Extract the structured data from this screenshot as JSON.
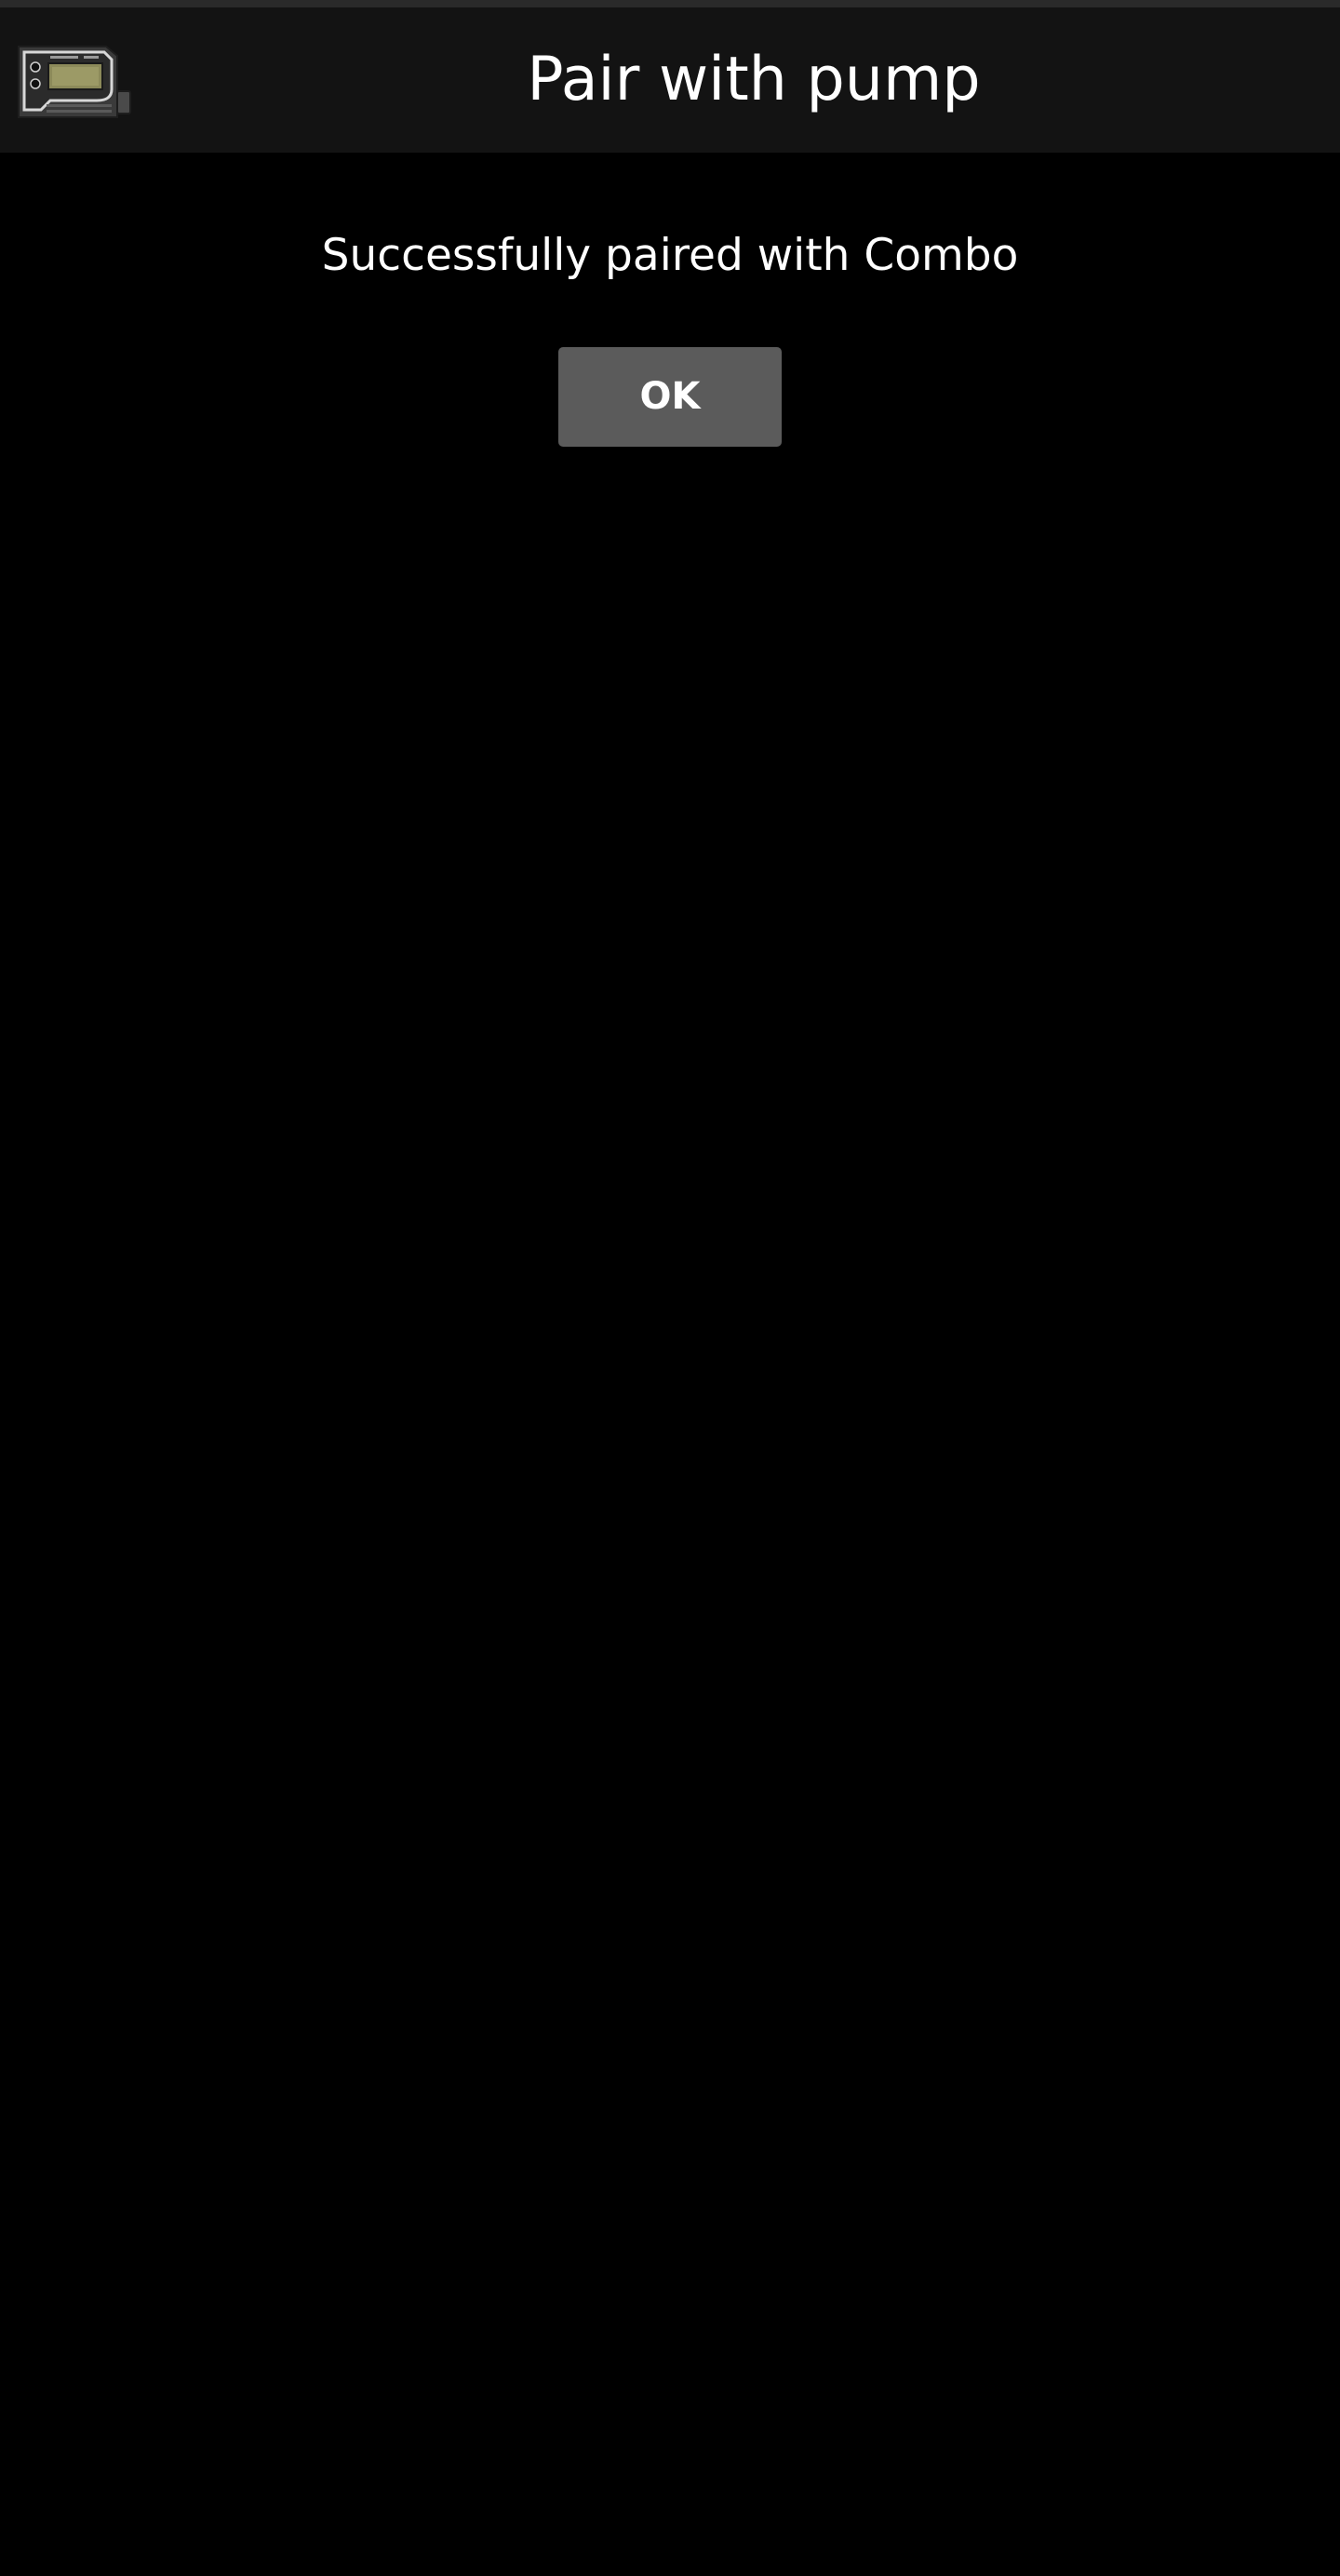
{
  "app_bar": {
    "title": "Pair with pump",
    "icon": "insulin-pump-icon"
  },
  "content": {
    "message": "Successfully paired with Combo",
    "ok_label": "OK"
  },
  "colors": {
    "background": "#000000",
    "app_bar": "#131313",
    "button": "#5b5b5b",
    "text": "#ffffff"
  }
}
